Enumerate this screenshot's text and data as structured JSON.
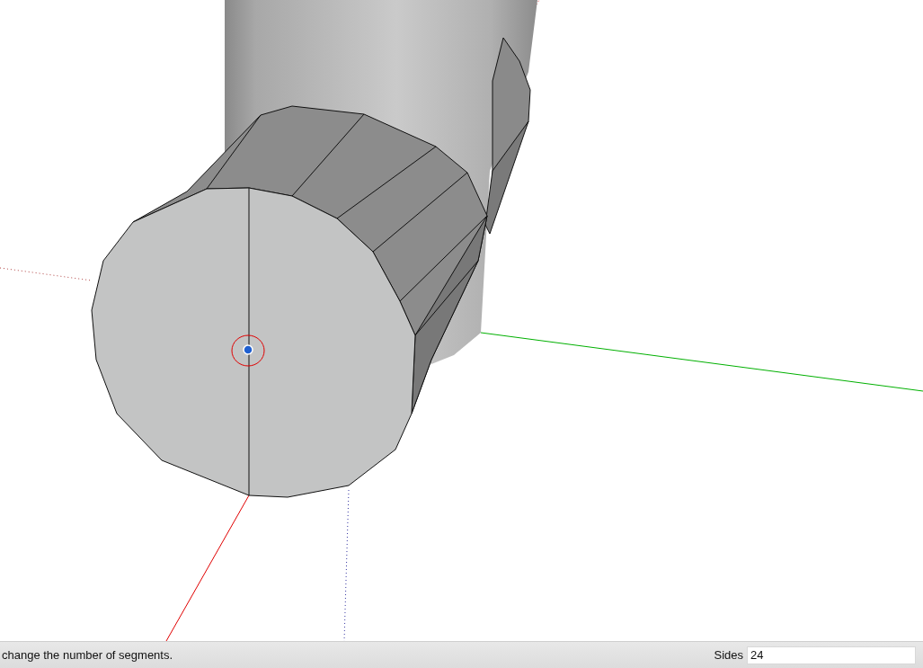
{
  "status_bar": {
    "message": "change the number of segments.",
    "value_control": {
      "label": "Sides",
      "value": "24"
    }
  }
}
